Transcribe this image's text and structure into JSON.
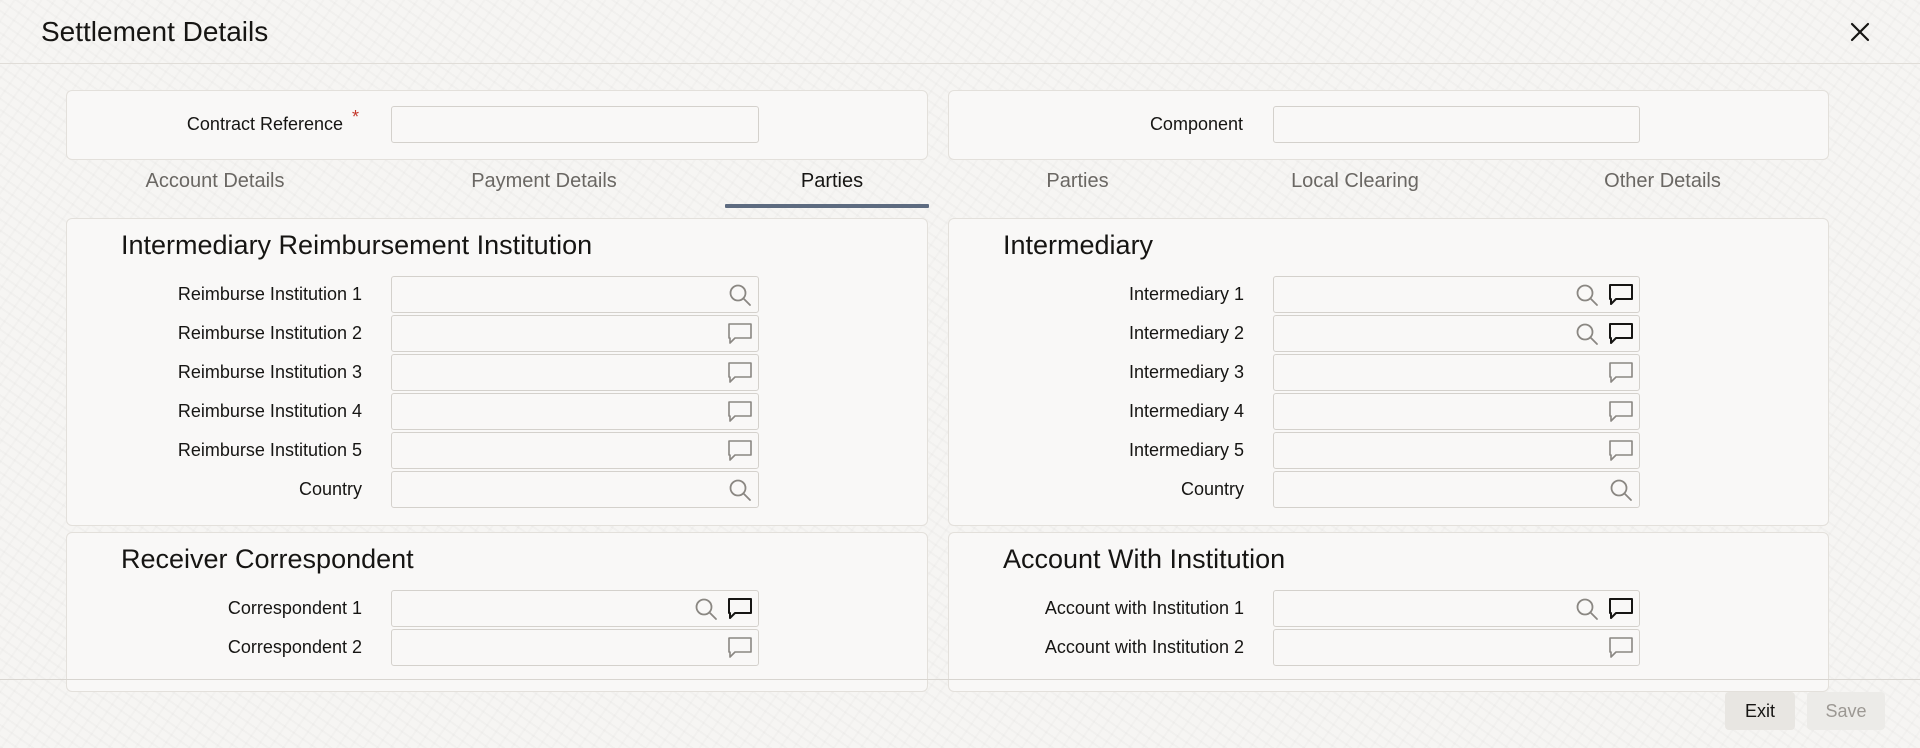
{
  "window": {
    "title": "Settlement Details"
  },
  "header_form": {
    "contract_reference_label": "Contract Reference",
    "required_marker": "*",
    "contract_reference_value": "",
    "component_label": "Component",
    "component_value": ""
  },
  "tabs": [
    {
      "label": "Account Details",
      "active": false
    },
    {
      "label": "Payment Details",
      "active": false
    },
    {
      "label": "Parties",
      "active": true
    },
    {
      "label": "Parties",
      "active": false
    },
    {
      "label": "Local Clearing",
      "active": false
    },
    {
      "label": "Other Details",
      "active": false
    }
  ],
  "sections": {
    "intermediary_reimbursement": {
      "title": "Intermediary Reimbursement Institution",
      "fields": [
        {
          "label": "Reimburse Institution 1",
          "value": "",
          "icons": [
            "search-icon"
          ]
        },
        {
          "label": "Reimburse Institution 2",
          "value": "",
          "icons": [
            "chat-icon"
          ]
        },
        {
          "label": "Reimburse Institution 3",
          "value": "",
          "icons": [
            "chat-icon"
          ]
        },
        {
          "label": "Reimburse Institution 4",
          "value": "",
          "icons": [
            "chat-icon"
          ]
        },
        {
          "label": "Reimburse Institution 5",
          "value": "",
          "icons": [
            "chat-icon"
          ]
        },
        {
          "label": "Country",
          "value": "",
          "icons": [
            "search-icon"
          ]
        }
      ]
    },
    "intermediary": {
      "title": "Intermediary",
      "fields": [
        {
          "label": "Intermediary 1",
          "value": "",
          "icons": [
            "search-icon",
            "chat-icon-dark"
          ]
        },
        {
          "label": "Intermediary 2",
          "value": "",
          "icons": [
            "search-icon",
            "chat-icon-dark"
          ]
        },
        {
          "label": "Intermediary 3",
          "value": "",
          "icons": [
            "chat-icon"
          ]
        },
        {
          "label": "Intermediary 4",
          "value": "",
          "icons": [
            "chat-icon"
          ]
        },
        {
          "label": "Intermediary 5",
          "value": "",
          "icons": [
            "chat-icon"
          ]
        },
        {
          "label": "Country",
          "value": "",
          "icons": [
            "search-icon"
          ]
        }
      ]
    },
    "receiver_correspondent": {
      "title": "Receiver Correspondent",
      "fields": [
        {
          "label": "Correspondent 1",
          "value": "",
          "icons": [
            "search-icon",
            "chat-icon-dark"
          ]
        },
        {
          "label": "Correspondent 2",
          "value": "",
          "icons": [
            "chat-icon"
          ]
        }
      ]
    },
    "account_with_institution": {
      "title": "Account With Institution",
      "fields": [
        {
          "label": "Account with Institution 1",
          "value": "",
          "icons": [
            "search-icon",
            "chat-icon-dark"
          ]
        },
        {
          "label": "Account with Institution 2",
          "value": "",
          "icons": [
            "chat-icon"
          ]
        }
      ]
    }
  },
  "footer": {
    "exit_label": "Exit",
    "save_label": "Save"
  },
  "colors": {
    "accent_underline": "#5d6b80",
    "required": "#c3382c",
    "icon_light": "#8a8782",
    "icon_dark": "#161513"
  }
}
